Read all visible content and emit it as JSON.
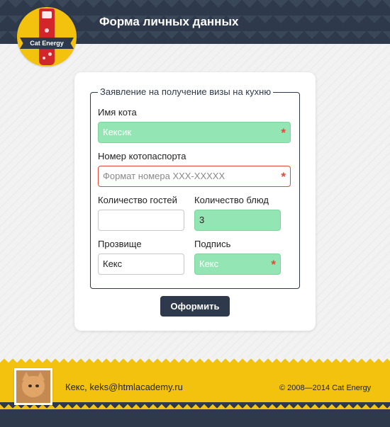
{
  "header": {
    "title": "Форма личных данных",
    "logo_text": "Cat Energy"
  },
  "form": {
    "legend": "Заявление на получение визы на кухню",
    "cat_name": {
      "label": "Имя кота",
      "value": "Кексик",
      "required_mark": "*"
    },
    "passport": {
      "label": "Номер котопаспорта",
      "placeholder": "Формат номера XXX-XXXXX",
      "required_mark": "*"
    },
    "guests": {
      "label": "Количество гостей",
      "value": ""
    },
    "dishes": {
      "label": "Количество блюд",
      "value": "3"
    },
    "nickname": {
      "label": "Прозвище",
      "value": "Кекс"
    },
    "signature": {
      "label": "Подпись",
      "value": "Кекс",
      "required_mark": "*"
    },
    "submit_label": "Оформить"
  },
  "footer": {
    "user": "Кекс, keks@htmlacademy.ru",
    "copyright": "© 2008—2014 Cat Energy"
  },
  "colors": {
    "dark": "#2e3a4b",
    "accent_yellow": "#f2c20f",
    "valid_green": "#93e6b3",
    "error_red": "#e04a38"
  }
}
